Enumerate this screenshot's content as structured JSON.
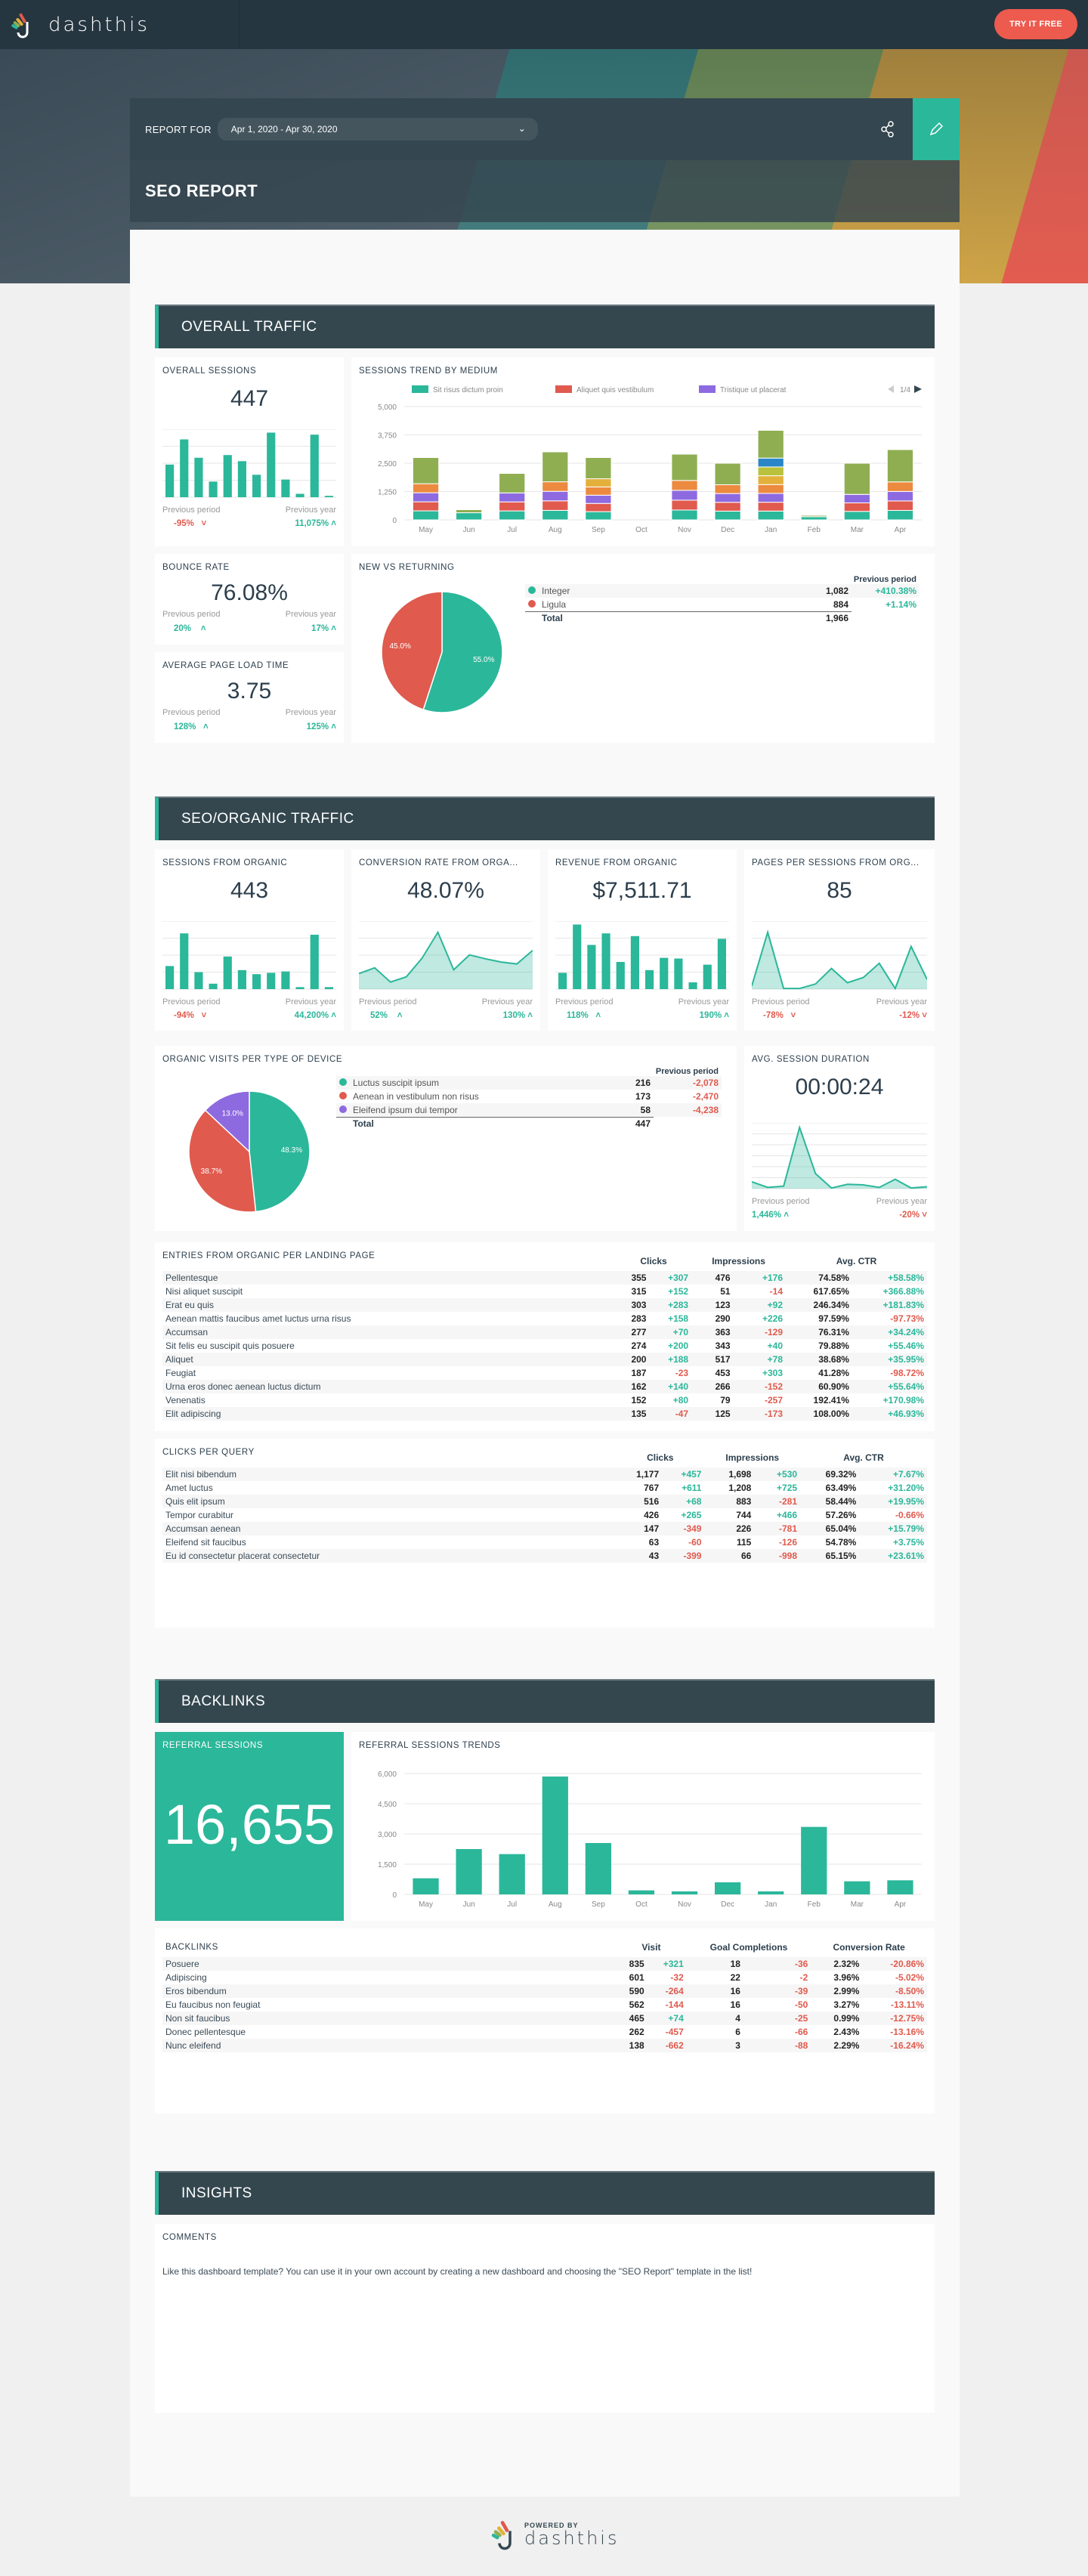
{
  "app": {
    "brand": "dashthis",
    "try_label": "TRY IT FREE"
  },
  "header": {
    "report_for_label": "REPORT FOR",
    "date_range": "Apr 1, 2020 - Apr 30, 2020",
    "title": "SEO REPORT"
  },
  "sections": {
    "overall": "OVERALL TRAFFIC",
    "seo": "SEO/ORGANIC TRAFFIC",
    "backlinks": "BACKLINKS",
    "insights": "INSIGHTS"
  },
  "labels": {
    "previous_period": "Previous period",
    "previous_year": "Previous year",
    "total": "Total"
  },
  "overall_sessions": {
    "title": "OVERALL SESSIONS",
    "value": "447",
    "prev_period": "-95%",
    "prev_year": "11,075%",
    "bars": [
      48,
      85,
      58,
      23,
      62,
      53,
      33,
      95,
      26,
      5,
      92,
      2
    ]
  },
  "sessions_trend": {
    "title": "SESSIONS TREND BY MEDIUM",
    "legend": [
      {
        "label": "Sit risus dictum proin",
        "color": "#2bb79a"
      },
      {
        "label": "Aliquet quis vestibulum",
        "color": "#e05a4e"
      },
      {
        "label": "Tristique ut placerat",
        "color": "#8e6ae0"
      }
    ],
    "pager": "1/4"
  },
  "bounce_rate": {
    "title": "BOUNCE RATE",
    "value": "76.08%",
    "prev_period": "20%",
    "prev_year": "17%"
  },
  "page_load": {
    "title": "AVERAGE PAGE LOAD TIME",
    "value": "3.75",
    "prev_period": "128%",
    "prev_year": "125%"
  },
  "new_vs_returning": {
    "title": "NEW VS RETURNING",
    "prev_header": "Previous period",
    "rows": [
      {
        "label": "Integer",
        "value": "1,082",
        "change": "+410.38%",
        "color": "#2bb79a",
        "pct": 55.0
      },
      {
        "label": "Ligula",
        "value": "884",
        "change": "+1.14%",
        "color": "#e05a4e",
        "pct": 45.0
      }
    ],
    "total": "1,966"
  },
  "sessions_organic": {
    "title": "SESSIONS FROM ORGANIC",
    "value": "443",
    "prev_period": "-94%",
    "prev_year": "44,200%",
    "bars": [
      34,
      82,
      25,
      8,
      48,
      28,
      22,
      24,
      26,
      3,
      80,
      3
    ]
  },
  "conversion_organic": {
    "title": "CONVERSION RATE FROM ORGA...",
    "value": "48.07%",
    "prev_period": "52%",
    "prev_year": "130%",
    "points": [
      24,
      33,
      11,
      19,
      48,
      88,
      30,
      53,
      47,
      42,
      39,
      60
    ]
  },
  "revenue_organic": {
    "title": "REVENUE FROM ORGANIC",
    "value": "$7,511.71",
    "prev_period": "118%",
    "prev_year": "190%",
    "bars": [
      24,
      95,
      65,
      82,
      40,
      78,
      28,
      46,
      45,
      10,
      36,
      74
    ]
  },
  "pages_per_session": {
    "title": "PAGES PER SESSIONS FROM ORG...",
    "value": "85",
    "prev_period": "-78%",
    "prev_year": "-12%",
    "points": [
      5,
      88,
      1,
      1,
      8,
      32,
      10,
      18,
      40,
      1,
      66,
      15
    ]
  },
  "device": {
    "title": "ORGANIC VISITS PER TYPE OF DEVICE",
    "prev_header": "Previous period",
    "rows": [
      {
        "label": "Luctus suscipit ipsum",
        "value": "216",
        "change": "-2,078",
        "color": "#2bb79a",
        "pct": 48.3
      },
      {
        "label": "Aenean in vestibulum non risus",
        "value": "173",
        "change": "-2,470",
        "color": "#e05a4e",
        "pct": 38.7
      },
      {
        "label": "Eleifend ipsum dui tempor",
        "value": "58",
        "change": "-4,238",
        "color": "#8e6ae0",
        "pct": 13.0
      }
    ],
    "total": "447"
  },
  "avg_session": {
    "title": "AVG. SESSION DURATION",
    "value": "00:00:24",
    "prev_period": "1,446%",
    "prev_year": "-20%",
    "points": [
      11,
      2,
      4,
      98,
      24,
      1,
      7,
      6,
      2,
      15,
      1,
      3
    ]
  },
  "landing_pages": {
    "title": "ENTRIES FROM ORGANIC PER LANDING PAGE",
    "headers": [
      "Clicks",
      "Impressions",
      "Avg. CTR"
    ],
    "rows": [
      [
        "Pellentesque",
        "355",
        "+307",
        "476",
        "+176",
        "74.58%",
        "+58.58%"
      ],
      [
        "Nisi aliquet suscipit",
        "315",
        "+152",
        "51",
        "-14",
        "617.65%",
        "+366.88%"
      ],
      [
        "Erat eu quis",
        "303",
        "+283",
        "123",
        "+92",
        "246.34%",
        "+181.83%"
      ],
      [
        "Aenean mattis faucibus amet luctus urna risus",
        "283",
        "+158",
        "290",
        "+226",
        "97.59%",
        "-97.73%"
      ],
      [
        "Accumsan",
        "277",
        "+70",
        "363",
        "-129",
        "76.31%",
        "+34.24%"
      ],
      [
        "Sit felis eu suscipit quis posuere",
        "274",
        "+200",
        "343",
        "+40",
        "79.88%",
        "+55.46%"
      ],
      [
        "Aliquet",
        "200",
        "+188",
        "517",
        "+78",
        "38.68%",
        "+35.95%"
      ],
      [
        "Feugiat",
        "187",
        "-23",
        "453",
        "+303",
        "41.28%",
        "-98.72%"
      ],
      [
        "Urna eros donec aenean luctus dictum",
        "162",
        "+140",
        "266",
        "-152",
        "60.90%",
        "+55.64%"
      ],
      [
        "Venenatis",
        "152",
        "+80",
        "79",
        "-257",
        "192.41%",
        "+170.98%"
      ],
      [
        "Elit adipiscing",
        "135",
        "-47",
        "125",
        "-173",
        "108.00%",
        "+46.93%"
      ]
    ]
  },
  "queries": {
    "title": "CLICKS PER QUERY",
    "headers": [
      "Clicks",
      "Impressions",
      "Avg. CTR"
    ],
    "rows": [
      [
        "Elit nisi bibendum",
        "1,177",
        "+457",
        "1,698",
        "+530",
        "69.32%",
        "+7.67%"
      ],
      [
        "Amet luctus",
        "767",
        "+611",
        "1,208",
        "+725",
        "63.49%",
        "+31.20%"
      ],
      [
        "Quis elit ipsum",
        "516",
        "+68",
        "883",
        "-281",
        "58.44%",
        "+19.95%"
      ],
      [
        "Tempor curabitur",
        "426",
        "+265",
        "744",
        "+466",
        "57.26%",
        "-0.66%"
      ],
      [
        "Accumsan aenean",
        "147",
        "-349",
        "226",
        "-781",
        "65.04%",
        "+15.79%"
      ],
      [
        "Eleifend sit faucibus",
        "63",
        "-60",
        "115",
        "-126",
        "54.78%",
        "+3.75%"
      ],
      [
        "Eu id consectetur placerat consectetur",
        "43",
        "-399",
        "66",
        "-998",
        "65.15%",
        "+23.61%"
      ]
    ]
  },
  "referral": {
    "title": "REFERRAL SESSIONS",
    "value": "16,655"
  },
  "backlinks_table": {
    "title": "BACKLINKS",
    "headers": [
      "Visit",
      "Goal Completions",
      "Conversion Rate"
    ],
    "rows": [
      [
        "Posuere",
        "835",
        "+321",
        "18",
        "-36",
        "2.32%",
        "-20.86%"
      ],
      [
        "Adipiscing",
        "601",
        "-32",
        "22",
        "-2",
        "3.96%",
        "-5.02%"
      ],
      [
        "Eros bibendum",
        "590",
        "-264",
        "16",
        "-39",
        "2.99%",
        "-8.50%"
      ],
      [
        "Eu faucibus non feugiat",
        "562",
        "-144",
        "16",
        "-50",
        "3.27%",
        "-13.11%"
      ],
      [
        "Non sit faucibus",
        "465",
        "+74",
        "4",
        "-25",
        "0.99%",
        "-12.75%"
      ],
      [
        "Donec pellentesque",
        "262",
        "-457",
        "6",
        "-66",
        "2.43%",
        "-13.16%"
      ],
      [
        "Nunc eleifend",
        "138",
        "-662",
        "3",
        "-88",
        "2.29%",
        "-16.24%"
      ]
    ]
  },
  "insights": {
    "title": "COMMENTS",
    "text": "Like this dashboard template? You can use it in your own account by creating a new dashboard and choosing the \"SEO Report\" template in the list!"
  },
  "footer": {
    "powered_by": "POWERED BY",
    "brand": "dashthis"
  },
  "chart_data": [
    {
      "type": "bar",
      "title": "SESSIONS TREND BY MEDIUM",
      "stacked": true,
      "categories": [
        "May",
        "Jun",
        "Jul",
        "Aug",
        "Sep",
        "Oct",
        "Nov",
        "Dec",
        "Jan",
        "Feb",
        "Mar",
        "Apr"
      ],
      "ylim": [
        0,
        5000
      ],
      "yticks": [
        "0",
        "1,250",
        "2,500",
        "3,750",
        "5,000"
      ],
      "totals": [
        2750,
        450,
        2050,
        3000,
        2750,
        0,
        2900,
        2500,
        3950,
        200,
        2500,
        3100
      ],
      "other_share": [
        0.42,
        0.3,
        0.42,
        0.44,
        0.34,
        0,
        0.4,
        0.38,
        0.31,
        0.3,
        0.55,
        0.46
      ],
      "segment_colors": [
        "#2bb79a",
        "#e05a4e",
        "#8e6ae0",
        "#ec8a3f",
        "#e3b13b",
        "#b9c23a",
        "#2a86c6",
        "#5a9e6e",
        "#e86f4a",
        "#1d97b0",
        "#8fae52"
      ]
    },
    {
      "type": "bar",
      "title": "REFERRAL SESSIONS TRENDS",
      "categories": [
        "May",
        "Jun",
        "Jul",
        "Aug",
        "Sep",
        "Oct",
        "Nov",
        "Dec",
        "Jan",
        "Feb",
        "Mar",
        "Apr"
      ],
      "values": [
        800,
        2250,
        2000,
        5850,
        2550,
        200,
        150,
        600,
        150,
        3350,
        650,
        700
      ],
      "ylim": [
        0,
        6000
      ],
      "yticks": [
        "0",
        "1,500",
        "3,000",
        "4,500",
        "6,000"
      ]
    },
    {
      "type": "pie",
      "title": "NEW VS RETURNING",
      "labels": [
        "Integer",
        "Ligula"
      ],
      "values": [
        55.0,
        45.0
      ]
    },
    {
      "type": "pie",
      "title": "ORGANIC VISITS PER TYPE OF DEVICE",
      "labels": [
        "Luctus suscipit ipsum",
        "Aenean in vestibulum non risus",
        "Eleifend ipsum dui tempor"
      ],
      "values": [
        48.3,
        38.7,
        13.0
      ]
    }
  ]
}
